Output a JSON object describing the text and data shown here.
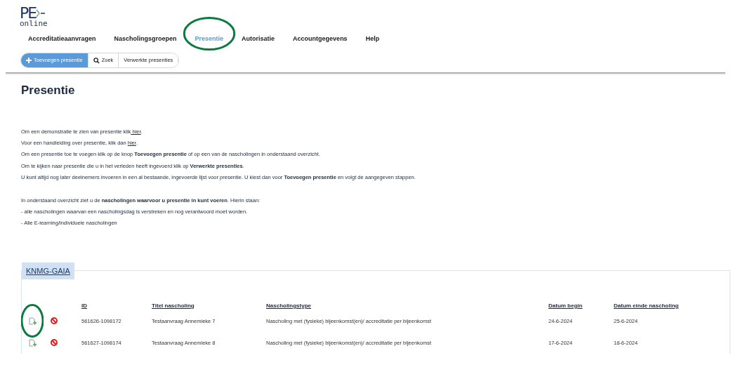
{
  "logo": {
    "mark": "PE",
    "sub": "online"
  },
  "nav": [
    {
      "label": "Accreditatieaanvragen",
      "selected": false,
      "circled": false
    },
    {
      "label": "Nascholingsgroepen",
      "selected": false,
      "circled": false
    },
    {
      "label": "Presentie",
      "selected": true,
      "circled": true
    },
    {
      "label": "Autorisatie",
      "selected": false,
      "circled": false
    },
    {
      "label": "Accountgegevens",
      "selected": false,
      "circled": false
    },
    {
      "label": "Help",
      "selected": false,
      "circled": false
    }
  ],
  "subnav": [
    {
      "label": "Toevoegen presentie",
      "kind": "add",
      "selected": true
    },
    {
      "label": "Zoek",
      "kind": "search",
      "selected": false
    },
    {
      "label": "Verwerkte presenties",
      "kind": "plain",
      "selected": false
    }
  ],
  "title": "Presentie",
  "intro": [
    {
      "before": "Om een demonstratie te zien van presentie klik",
      "link": " hier",
      "after": "."
    },
    {
      "before": "Voor een handleiding over presentie, klik dan ",
      "link": "hier",
      "after": "."
    },
    {
      "before": "Om een presentie toe te voegen klik op de knop **Toevoegen presentie** of op een van de nascholingen in onderstaand overzicht."
    },
    {
      "before": "Om te kijken naar presentie die u in het verleden heeft ingevoerd klik op **Verwerkte presenties**."
    },
    {
      "before": "U kunt altijd nog later deelnemers invoeren in een al bestaande, ingevoerde lijst voor presentie. U kiest dan voor **Toevoegen presentie** en volgt de aangegeven stappen."
    }
  ],
  "overview": [
    "In onderstaand overzicht ziet u de **nascholingen waarvoor u presentie in kunt voeren**. Hierin staan:",
    "- alle nascholingen waarvan een nascholingsdag is verstreken en nog verantwoord moet worden.",
    "- Alle E-learning/individuele nascholingen"
  ],
  "section": {
    "title": "KNMG-GAIA",
    "columns": [
      "ID",
      "Titel nascholing",
      "Nascholingstype",
      "Datum begin",
      "Datum einde nascholing"
    ],
    "rows": [
      {
        "circled": true,
        "cells": [
          "561626-1098172",
          "Testaanvraag Annemieke 7",
          "Nascholing met (fysieke) bijeenkomst(en)/ accreditatie per bijeenkomst",
          "24-6-2024",
          "25-6-2024"
        ]
      },
      {
        "circled": false,
        "cells": [
          "561627-1098174",
          "Testaanvraag Annemieke 8",
          "Nascholing met (fysieke) bijeenkomst(en)/ accreditatie per bijeenkomst",
          "17-6-2024",
          "18-6-2024"
        ]
      }
    ]
  }
}
